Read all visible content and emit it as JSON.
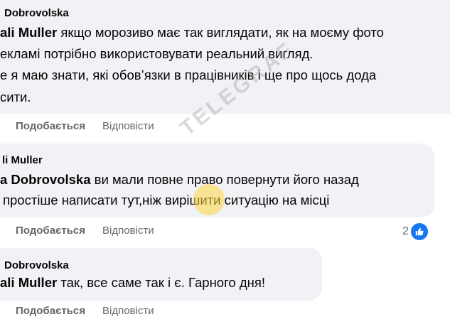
{
  "comments": [
    {
      "author": "Dobrovolska",
      "mention": "ali Muller",
      "lines": [
        "якщо морозиво має так виглядати, як на моєму фото",
        "екламі потрібно використовувати реальний вигляд.",
        "е я маю знати, які обов’язки в працівників і ще про щось дода",
        "сити."
      ],
      "like_label": "Подобається",
      "reply_label": "Відповісти"
    },
    {
      "author": "li Muller",
      "mention": "a Dobrovolska",
      "lines": [
        "ви мали повне право повернути його назад",
        "простіше написати тут,ніж вирішити ситуацію на місці"
      ],
      "like_label": "Подобається",
      "reply_label": "Відповісти",
      "reaction_count": "2"
    },
    {
      "author": "Dobrovolska",
      "mention": "ali Muller",
      "lines": [
        "так, все саме так і є. Гарного дня!"
      ],
      "like_label": "Подобається",
      "reply_label": "Відповісти"
    }
  ],
  "watermark": "TELEGRAF",
  "colors": {
    "bubble": "#f0f2f5",
    "text": "#050505",
    "secondary": "#65676b",
    "like_blue": "#1877f2"
  }
}
